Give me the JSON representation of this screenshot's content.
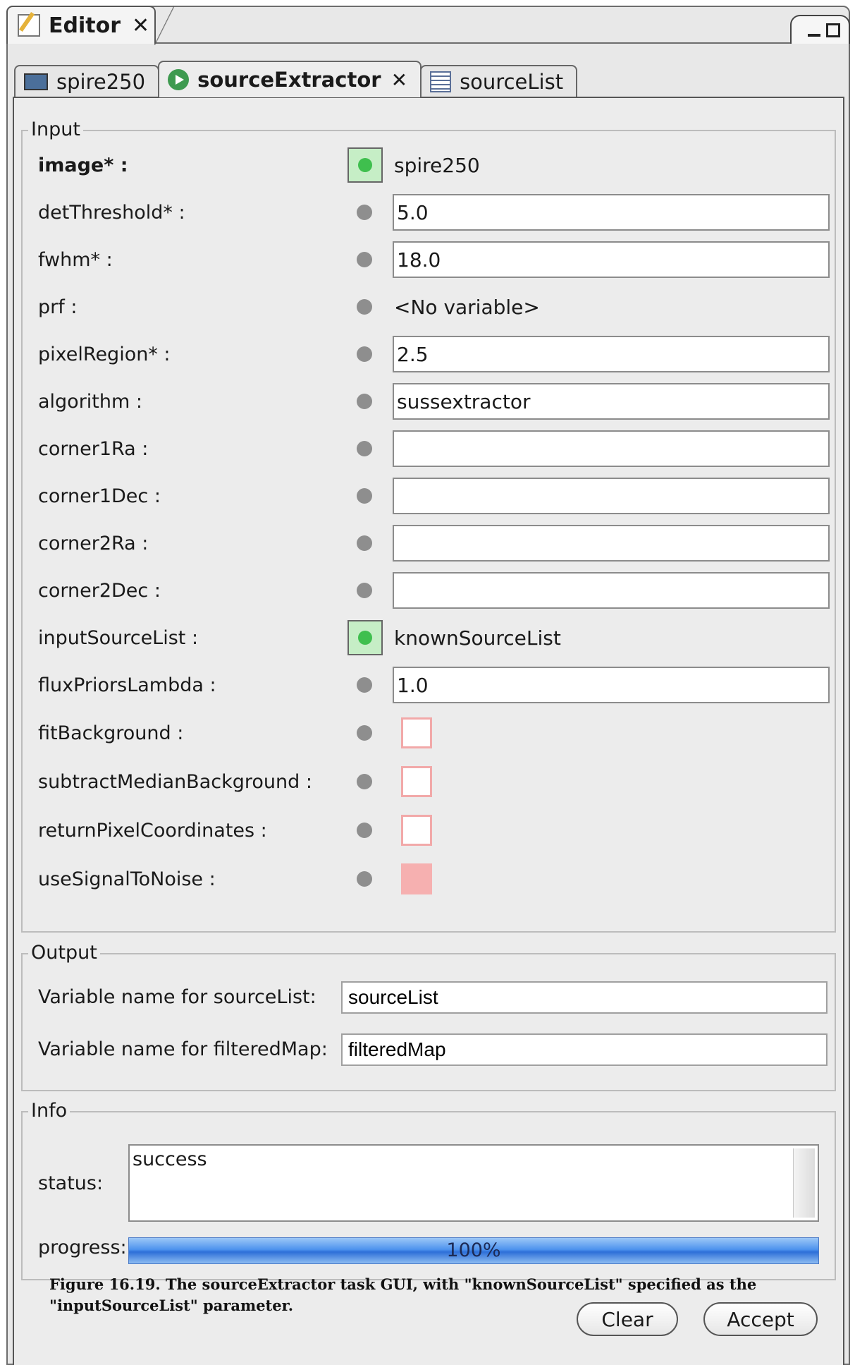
{
  "editor": {
    "tab_label": "Editor",
    "close_glyph": "✕"
  },
  "tabs": [
    {
      "label": "spire250",
      "icon": "monitor-icon"
    },
    {
      "label": "sourceExtractor",
      "icon": "play-icon",
      "active": true
    },
    {
      "label": "sourceList",
      "icon": "list-icon"
    }
  ],
  "input": {
    "legend": "Input",
    "rows": [
      {
        "label": "image* :",
        "kind": "variable",
        "value": "spire250"
      },
      {
        "label": "detThreshold* :",
        "kind": "text",
        "value": "5.0"
      },
      {
        "label": "fwhm* :",
        "kind": "text",
        "value": "18.0"
      },
      {
        "label": "prf :",
        "kind": "static",
        "value": "<No variable>"
      },
      {
        "label": "pixelRegion* :",
        "kind": "text",
        "value": "2.5"
      },
      {
        "label": "algorithm :",
        "kind": "text",
        "value": "sussextractor"
      },
      {
        "label": "corner1Ra :",
        "kind": "text",
        "value": ""
      },
      {
        "label": "corner1Dec :",
        "kind": "text",
        "value": ""
      },
      {
        "label": "corner2Ra :",
        "kind": "text",
        "value": ""
      },
      {
        "label": "corner2Dec :",
        "kind": "text",
        "value": ""
      },
      {
        "label": "inputSourceList :",
        "kind": "variable",
        "value": "knownSourceList"
      },
      {
        "label": "fluxPriorsLambda :",
        "kind": "text",
        "value": "1.0"
      },
      {
        "label": "fitBackground :",
        "kind": "checkbox",
        "checked": false
      },
      {
        "label": "subtractMedianBackground :",
        "kind": "checkbox",
        "checked": false
      },
      {
        "label": "returnPixelCoordinates :",
        "kind": "checkbox",
        "checked": false
      },
      {
        "label": "useSignalToNoise :",
        "kind": "checkbox",
        "checked": true
      }
    ]
  },
  "output": {
    "legend": "Output",
    "source_list_label": "Variable name for sourceList:",
    "source_list_value": "sourceList",
    "filtered_map_label": "Variable name for filteredMap:",
    "filtered_map_value": "filteredMap"
  },
  "info": {
    "legend": "Info",
    "status_label": "status:",
    "status_value": "success",
    "progress_label": "progress:",
    "progress_value": 100,
    "progress_text": "100%"
  },
  "caption": "Figure 16.19. The sourceExtractor task GUI, with \"knownSourceList\" specified as the \"inputSourceList\" parameter.",
  "buttons": {
    "clear": "Clear",
    "accept": "Accept"
  },
  "colors": {
    "accent_green": "#3fbf4e",
    "checkbox_red": "#f6b0b0",
    "progress_blue": "#2d6fd8"
  }
}
